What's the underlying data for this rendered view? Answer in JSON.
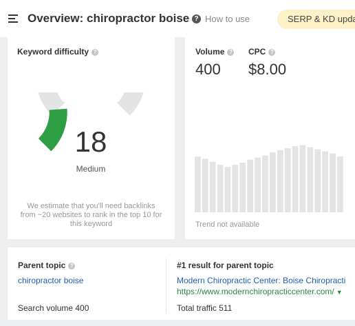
{
  "header": {
    "title": "Overview: chiropractor boise",
    "help_link": "How to use",
    "badge": "SERP & KD updat"
  },
  "keyword_difficulty": {
    "label": "Keyword difficulty",
    "value": "18",
    "score": 18,
    "level": "Medium",
    "note": "We estimate that you'll need backlinks from ~20 websites to rank in the top 10 for this keyword",
    "colors": {
      "filled": "#2e9e45",
      "track": "#e4e4e4"
    }
  },
  "volume": {
    "label": "Volume",
    "value": "400"
  },
  "cpc": {
    "label": "CPC",
    "value": "$8.00"
  },
  "trend": {
    "note": "Trend not available",
    "bar_color": "#e4e4e4",
    "levels": [
      0.54,
      0.52,
      0.49,
      0.46,
      0.44,
      0.46,
      0.48,
      0.51,
      0.53,
      0.55,
      0.58,
      0.6,
      0.62,
      0.64,
      0.65,
      0.63,
      0.61,
      0.59,
      0.57,
      0.54
    ]
  },
  "parent_topic": {
    "label": "Parent topic",
    "link": "chiropractor boise",
    "search_volume": "Search volume 400"
  },
  "first_result": {
    "label": "#1 result for parent topic",
    "title": "Modern Chiropractic Center: Boise Chiropracti",
    "url": "https://www.modernchiropracticcenter.com/",
    "traffic": "Total traffic 511"
  }
}
